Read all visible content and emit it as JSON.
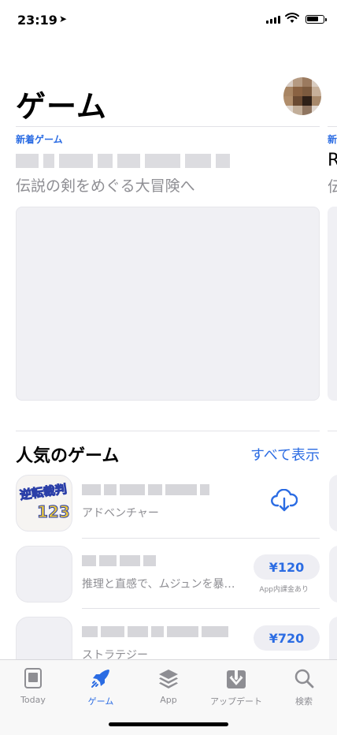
{
  "status": {
    "time": "23:19",
    "location_icon": "location-arrow-icon"
  },
  "header": {
    "title": "ゲーム"
  },
  "feature": {
    "tag": "新着ゲーム",
    "subtitle": "伝説の剣をめぐる大冒険へ"
  },
  "feature_peek": {
    "tag": "新",
    "name": "R",
    "subtitle": "伝"
  },
  "popular": {
    "title": "人気のゲーム",
    "see_all": "すべて表示",
    "items": [
      {
        "subtitle": "アドベンチャー",
        "action": "cloud-download-icon",
        "icon_text": "逆転裁判",
        "icon_num": "123"
      },
      {
        "subtitle": "推理と直感で、ムジュンを暴…",
        "price": "¥120",
        "iap": "App内課金あり"
      },
      {
        "subtitle": "ストラテジー",
        "price": "¥720"
      }
    ]
  },
  "tabs": [
    {
      "label": "Today",
      "icon": "today-icon",
      "active": false
    },
    {
      "label": "ゲーム",
      "icon": "rocket-icon",
      "active": true
    },
    {
      "label": "App",
      "icon": "layers-icon",
      "active": false
    },
    {
      "label": "アップデート",
      "icon": "download-tray-icon",
      "active": false
    },
    {
      "label": "検索",
      "icon": "search-icon",
      "active": false
    }
  ],
  "colors": {
    "accent": "#2b6ce3",
    "secondary_text": "#8e8e93",
    "placeholder": "#f0f0f4"
  }
}
